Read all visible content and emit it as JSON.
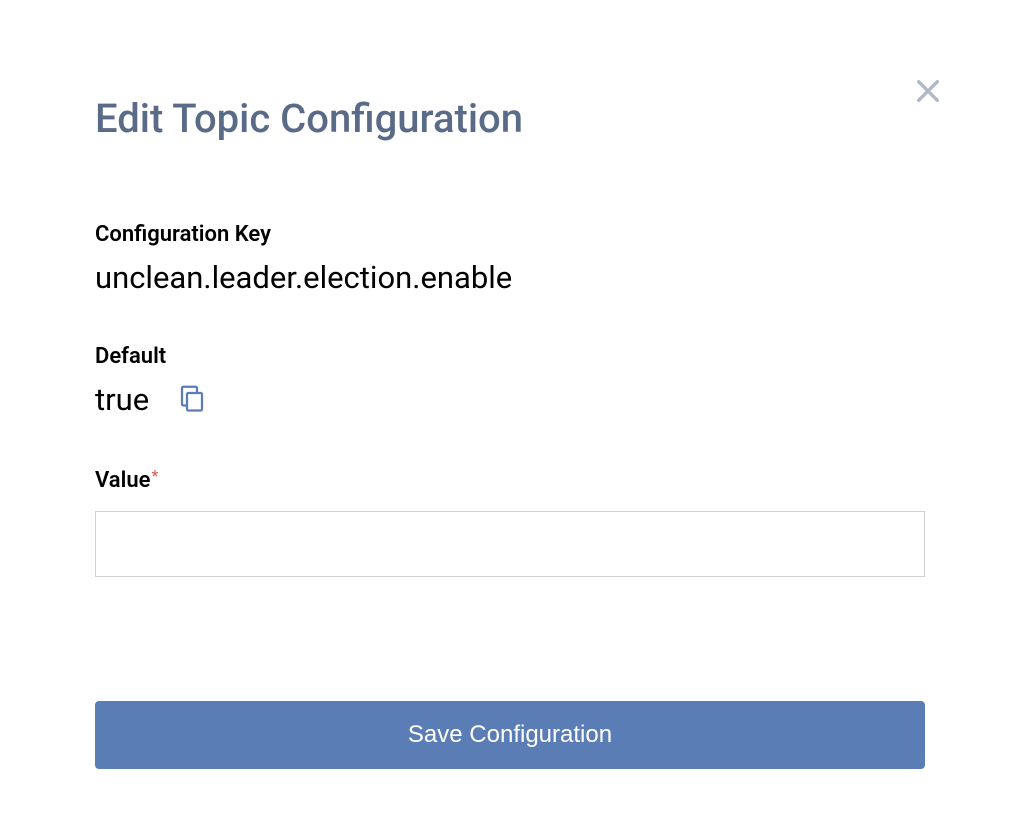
{
  "dialog": {
    "title": "Edit Topic Configuration",
    "fields": {
      "configKey": {
        "label": "Configuration Key",
        "value": "unclean.leader.election.enable"
      },
      "default": {
        "label": "Default",
        "value": "true"
      },
      "valueField": {
        "label": "Value",
        "required": "*",
        "inputValue": ""
      }
    },
    "buttons": {
      "save": "Save Configuration"
    }
  }
}
